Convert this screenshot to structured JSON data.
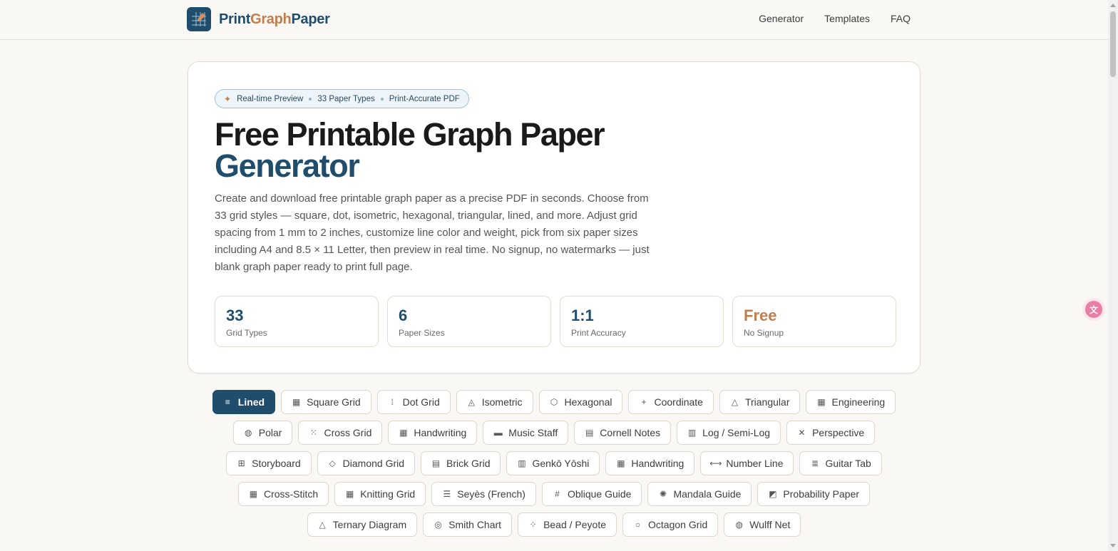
{
  "brand": {
    "part1": "Print",
    "part2": "Graph",
    "part3": "Paper"
  },
  "nav": [
    "Generator",
    "Templates",
    "FAQ"
  ],
  "hero": {
    "pill": [
      "Real-time Preview",
      "33 Paper Types",
      "Print-Accurate PDF"
    ],
    "title_line1": "Free Printable Graph Paper",
    "title_line2": "Generator",
    "description": "Create and download free printable graph paper as a precise PDF in seconds. Choose from 33 grid styles — square, dot, isometric, hexagonal, triangular, lined, and more. Adjust grid spacing from 1 mm to 2 inches, customize line color and weight, pick from six paper sizes including A4 and 8.5 × 11 Letter, then preview in real time. No signup, no watermarks — just blank graph paper ready to print full page.",
    "stats": [
      {
        "value": "33",
        "label": "Grid Types"
      },
      {
        "value": "6",
        "label": "Paper Sizes"
      },
      {
        "value": "1:1",
        "label": "Print Accuracy"
      },
      {
        "value": "Free",
        "label": "No Signup"
      }
    ]
  },
  "grid_types": {
    "rows": [
      [
        {
          "label": "Lined",
          "icon": "lines-icon",
          "glyph": "≡",
          "active": true
        },
        {
          "label": "Square Grid",
          "icon": "square-grid-icon",
          "glyph": "▦"
        },
        {
          "label": "Dot Grid",
          "icon": "dot-grid-icon",
          "glyph": "⁞"
        },
        {
          "label": "Isometric",
          "icon": "isometric-icon",
          "glyph": "◬"
        },
        {
          "label": "Hexagonal",
          "icon": "hexagon-icon",
          "glyph": "⬡"
        },
        {
          "label": "Coordinate",
          "icon": "plus-icon",
          "glyph": "+"
        },
        {
          "label": "Triangular",
          "icon": "triangle-icon",
          "glyph": "△"
        },
        {
          "label": "Engineering",
          "icon": "engineering-icon",
          "glyph": "▦"
        }
      ],
      [
        {
          "label": "Polar",
          "icon": "polar-icon",
          "glyph": "◍"
        },
        {
          "label": "Cross Grid",
          "icon": "cross-grid-icon",
          "glyph": "⁙"
        },
        {
          "label": "Handwriting",
          "icon": "handwriting-icon",
          "glyph": "▦"
        },
        {
          "label": "Music Staff",
          "icon": "music-staff-icon",
          "glyph": "▬"
        },
        {
          "label": "Cornell Notes",
          "icon": "cornell-notes-icon",
          "glyph": "▤"
        },
        {
          "label": "Log / Semi-Log",
          "icon": "log-icon",
          "glyph": "▥"
        },
        {
          "label": "Perspective",
          "icon": "perspective-icon",
          "glyph": "✕"
        }
      ],
      [
        {
          "label": "Storyboard",
          "icon": "storyboard-icon",
          "glyph": "⊞"
        },
        {
          "label": "Diamond Grid",
          "icon": "diamond-icon",
          "glyph": "◇"
        },
        {
          "label": "Brick Grid",
          "icon": "brick-icon",
          "glyph": "▤"
        },
        {
          "label": "Genkō Yōshi",
          "icon": "genko-icon",
          "glyph": "▥"
        },
        {
          "label": "Handwriting",
          "icon": "handwriting-icon",
          "glyph": "▦"
        },
        {
          "label": "Number Line",
          "icon": "number-line-icon",
          "glyph": "⟷"
        },
        {
          "label": "Guitar Tab",
          "icon": "guitar-tab-icon",
          "glyph": "≣"
        }
      ],
      [
        {
          "label": "Cross-Stitch",
          "icon": "cross-stitch-icon",
          "glyph": "▦"
        },
        {
          "label": "Knitting Grid",
          "icon": "knitting-icon",
          "glyph": "▦"
        },
        {
          "label": "Seyès (French)",
          "icon": "seyes-icon",
          "glyph": "☰"
        },
        {
          "label": "Oblique Guide",
          "icon": "oblique-icon",
          "glyph": "#"
        },
        {
          "label": "Mandala Guide",
          "icon": "mandala-icon",
          "glyph": "✺"
        },
        {
          "label": "Probability Paper",
          "icon": "probability-icon",
          "glyph": "◩"
        }
      ],
      [
        {
          "label": "Ternary Diagram",
          "icon": "ternary-icon",
          "glyph": "△"
        },
        {
          "label": "Smith Chart",
          "icon": "smith-chart-icon",
          "glyph": "◎"
        },
        {
          "label": "Bead / Peyote",
          "icon": "bead-icon",
          "glyph": "⁘"
        },
        {
          "label": "Octagon Grid",
          "icon": "octagon-icon",
          "glyph": "○"
        },
        {
          "label": "Wulff Net",
          "icon": "globe-icon",
          "glyph": "◍"
        }
      ]
    ]
  },
  "colors": {
    "primary": "#1f4d6b",
    "accent": "#c27d4e",
    "background": "#faf8f4"
  }
}
